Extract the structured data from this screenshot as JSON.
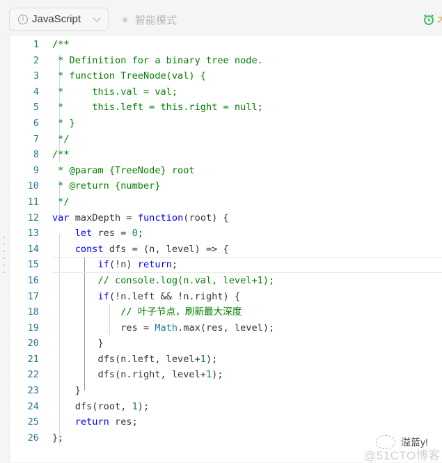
{
  "toolbar": {
    "language": "JavaScript",
    "language_icon": "info-icon",
    "smart_mode": "智能模式",
    "right_icon": "alarm-clock-icon",
    "right_text": "术"
  },
  "editor": {
    "active_line": 15,
    "lines": [
      {
        "n": "1",
        "tokens": [
          [
            "c",
            "/**"
          ]
        ]
      },
      {
        "n": "2",
        "tokens": [
          [
            "c",
            " * Definition for a binary tree node."
          ]
        ]
      },
      {
        "n": "3",
        "tokens": [
          [
            "c",
            " * function TreeNode(val) {"
          ]
        ]
      },
      {
        "n": "4",
        "tokens": [
          [
            "c",
            " *     this.val = val;"
          ]
        ]
      },
      {
        "n": "5",
        "tokens": [
          [
            "c",
            " *     this.left = this.right = null;"
          ]
        ]
      },
      {
        "n": "6",
        "tokens": [
          [
            "c",
            " * }"
          ]
        ]
      },
      {
        "n": "7",
        "tokens": [
          [
            "c",
            " */"
          ]
        ]
      },
      {
        "n": "8",
        "tokens": [
          [
            "c",
            "/**"
          ]
        ]
      },
      {
        "n": "9",
        "tokens": [
          [
            "c",
            " * @param {TreeNode} root"
          ]
        ]
      },
      {
        "n": "10",
        "tokens": [
          [
            "c",
            " * @return {number}"
          ]
        ]
      },
      {
        "n": "11",
        "tokens": [
          [
            "c",
            " */"
          ]
        ]
      },
      {
        "n": "12",
        "tokens": [
          [
            "k",
            "var"
          ],
          [
            "p",
            " maxDepth = "
          ],
          [
            "k",
            "function"
          ],
          [
            "p",
            "(root) {"
          ]
        ]
      },
      {
        "n": "13",
        "tokens": [
          [
            "p",
            "    "
          ],
          [
            "k",
            "let"
          ],
          [
            "p",
            " res = "
          ],
          [
            "n",
            "0"
          ],
          [
            "p",
            ";"
          ]
        ]
      },
      {
        "n": "14",
        "tokens": [
          [
            "p",
            "    "
          ],
          [
            "k",
            "const"
          ],
          [
            "p",
            " dfs = (n, level) => {"
          ]
        ]
      },
      {
        "n": "15",
        "tokens": [
          [
            "p",
            "        "
          ],
          [
            "k",
            "if"
          ],
          [
            "p",
            "(!n) "
          ],
          [
            "k",
            "return"
          ],
          [
            "p",
            ";"
          ]
        ]
      },
      {
        "n": "16",
        "tokens": [
          [
            "p",
            "        "
          ],
          [
            "c",
            "// console.log(n.val, level+1);"
          ]
        ]
      },
      {
        "n": "17",
        "tokens": [
          [
            "p",
            "        "
          ],
          [
            "k",
            "if"
          ],
          [
            "p",
            "(!n.left && !n.right) {"
          ]
        ]
      },
      {
        "n": "18",
        "tokens": [
          [
            "p",
            "            "
          ],
          [
            "c",
            "// 叶子节点，刷新最大深度"
          ]
        ]
      },
      {
        "n": "19",
        "tokens": [
          [
            "p",
            "            res = "
          ],
          [
            "t",
            "Math"
          ],
          [
            "p",
            ".max(res, level);"
          ]
        ]
      },
      {
        "n": "20",
        "tokens": [
          [
            "p",
            "        }"
          ]
        ]
      },
      {
        "n": "21",
        "tokens": [
          [
            "p",
            "        dfs(n.left, level+"
          ],
          [
            "n",
            "1"
          ],
          [
            "p",
            ");"
          ]
        ]
      },
      {
        "n": "22",
        "tokens": [
          [
            "p",
            "        dfs(n.right, level+"
          ],
          [
            "n",
            "1"
          ],
          [
            "p",
            ");"
          ]
        ]
      },
      {
        "n": "23",
        "tokens": [
          [
            "p",
            "    }"
          ]
        ]
      },
      {
        "n": "24",
        "tokens": [
          [
            "p",
            "    dfs(root, "
          ],
          [
            "n",
            "1"
          ],
          [
            "p",
            ");"
          ]
        ]
      },
      {
        "n": "25",
        "tokens": [
          [
            "p",
            "    "
          ],
          [
            "k",
            "return"
          ],
          [
            "p",
            " res;"
          ]
        ]
      },
      {
        "n": "26",
        "tokens": [
          [
            "p",
            "};"
          ]
        ]
      }
    ]
  },
  "watermark": {
    "author": "溢蓝y!",
    "site": "@51CTO博客"
  }
}
